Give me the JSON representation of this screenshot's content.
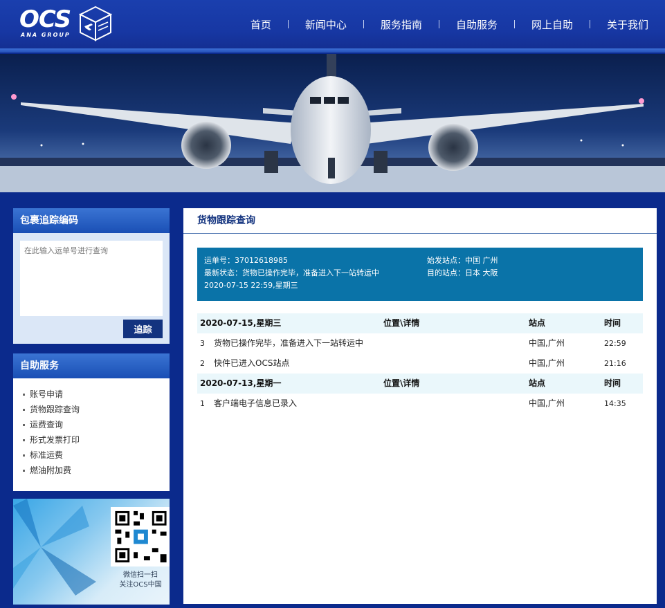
{
  "header": {
    "logo_text": "OCS",
    "logo_sub": "ANA GROUP",
    "nav": [
      "首页",
      "新闻中心",
      "服务指南",
      "自助服务",
      "网上自助",
      "关于我们"
    ]
  },
  "sidebar": {
    "track": {
      "title": "包裹追踪编码",
      "placeholder": "在此输入运单号进行查询",
      "button": "追踪"
    },
    "self_service": {
      "title": "自助服务",
      "items": [
        "账号申请",
        "货物跟踪查询",
        "运费查询",
        "形式发票打印",
        "标准运费",
        "燃油附加费"
      ]
    },
    "qr": {
      "line1": "微信扫一扫",
      "line2": "关注OCS中国"
    }
  },
  "main": {
    "title": "货物跟踪查询",
    "summary": {
      "waybill": "运单号：37012618985",
      "status": "最新状态：货物已操作完毕，准备进入下一站转运中",
      "datetime": "2020-07-15 22:59,星期三",
      "origin": "始发站点：中国 广州",
      "destination": "目的站点：日本 大阪"
    },
    "groups": [
      {
        "date": "2020-07-15,星期三",
        "col_location": "位置\\详情",
        "col_site": "站点",
        "col_time": "时间",
        "events": [
          {
            "num": "3",
            "desc": "货物已操作完毕，准备进入下一站转运中",
            "site": "中国,广州",
            "time": "22:59"
          },
          {
            "num": "2",
            "desc": "快件已进入OCS站点",
            "site": "中国,广州",
            "time": "21:16"
          }
        ]
      },
      {
        "date": "2020-07-13,星期一",
        "col_location": "位置\\详情",
        "col_site": "站点",
        "col_time": "时间",
        "events": [
          {
            "num": "1",
            "desc": "客户端电子信息已录入",
            "site": "中国,广州",
            "time": "14:35"
          }
        ]
      }
    ]
  },
  "colors": {
    "page_bg": "#0b2a8c",
    "header_bg": "#1737a3",
    "summary_bg": "#0a73a8",
    "title_text": "#13337f",
    "row_head_bg": "#eaf7fb"
  }
}
